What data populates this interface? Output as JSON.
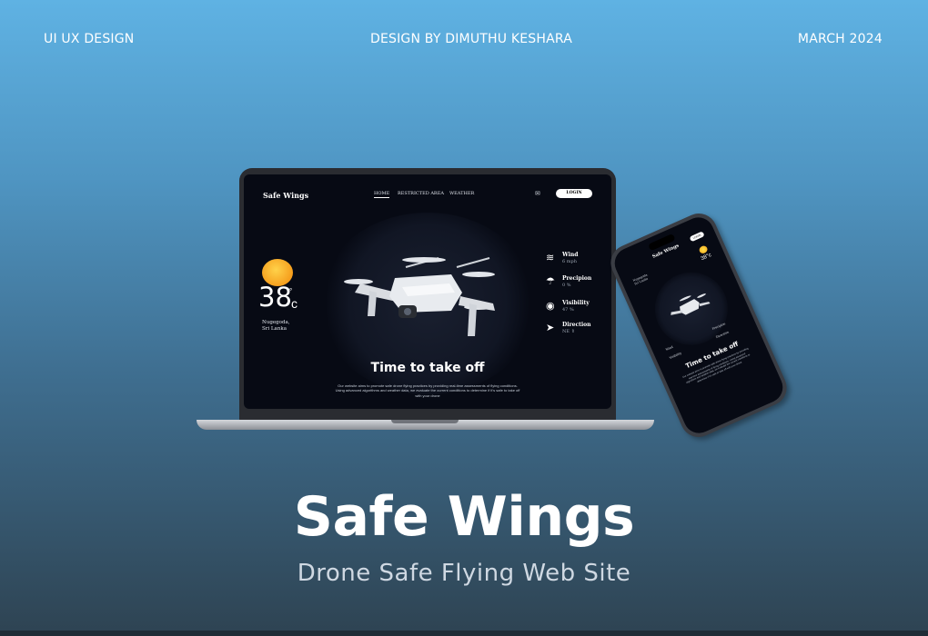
{
  "header": {
    "left": "UI  UX DESIGN",
    "center": "DESIGN BY DIMUTHU KESHARA",
    "right": "MARCH 2024"
  },
  "laptop_site": {
    "brand": "Safe Wings",
    "nav": [
      "HOME",
      "RESTRICTED AREA",
      "WEATHER"
    ],
    "login": "LOGIN",
    "weather": {
      "temperature": "38",
      "degree": "°",
      "unit": "c",
      "city": "Nugegoda,",
      "country": "Sri Lanka"
    },
    "stats": [
      {
        "name": "Wind",
        "value": "6 mph",
        "icon": "wind-icon"
      },
      {
        "name": "Precipion",
        "value": "0 %",
        "icon": "umbrella-icon"
      },
      {
        "name": "Visibility",
        "value": "47 %",
        "icon": "eye-icon"
      },
      {
        "name": "Direction",
        "value": "NE ⇑",
        "icon": "compass-icon"
      }
    ],
    "headline": "Time to take off",
    "description": "Our website aims to promote safe drone flying practices by providing real-time assessments of flying conditions. Using advanced algorithms and weather data, we evaluate the current conditions to determine if it's safe to take off with your drone"
  },
  "phone_site": {
    "brand": "Safe Wings",
    "login": "LOGIN",
    "temperature": "38°c",
    "city": "Nugegoda,",
    "country": "Sri Lanka",
    "stats": [
      "Wind",
      "Precipion",
      "Visibility",
      "Direction"
    ],
    "headline": "Time to take off",
    "description": "Our website aims to promote safe drone flying practices by providing real-time assessments of flying conditions. Using advanced algorithms and weather data, we evaluate the current conditions to determine if it's safe to take off with your drone"
  },
  "hero": {
    "title": "Safe Wings",
    "subtitle": "Drone Safe Flying Web Site"
  },
  "colors": {
    "bg_top": "#5fb2e3",
    "bg_bottom": "#2e4352",
    "screen_bg": "#070a14",
    "sun_yellow": "#ffd24a",
    "sun_orange": "#f59b1a"
  }
}
